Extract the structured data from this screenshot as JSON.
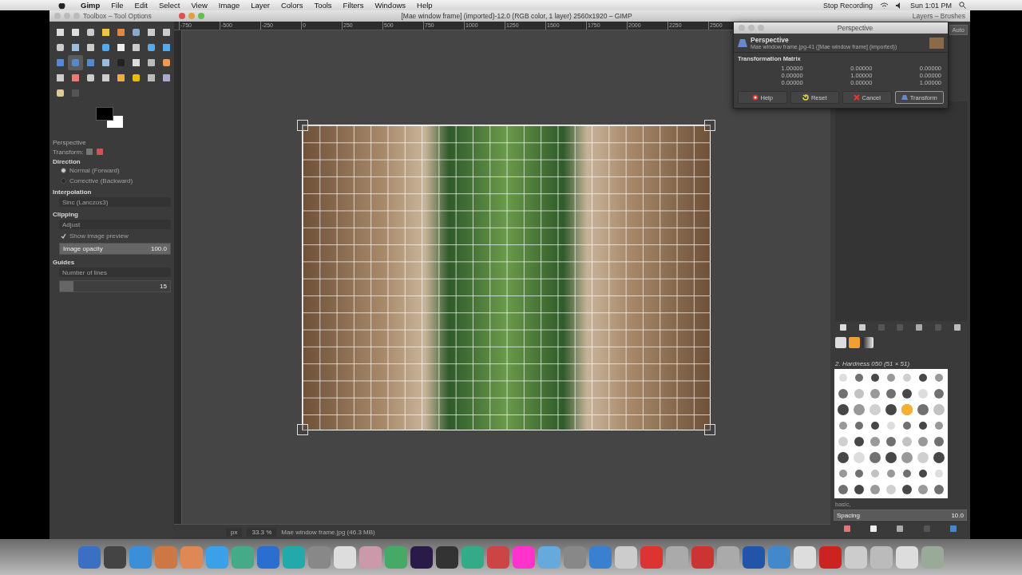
{
  "menu_bar": {
    "app": "Gimp",
    "menus": [
      "File",
      "Edit",
      "Select",
      "View",
      "Image",
      "Layer",
      "Colors",
      "Tools",
      "Filters",
      "Windows",
      "Help"
    ],
    "recording": "Stop Recording",
    "clock": "Sun 1:01 PM"
  },
  "toolbox": {
    "title": "Toolbox – Tool Options",
    "tools": [
      {
        "selected": false
      },
      {
        "selected": false
      },
      {
        "selected": false
      },
      {
        "selected": false
      },
      {
        "selected": false
      },
      {
        "selected": false
      },
      {
        "selected": false
      },
      {
        "selected": false
      },
      {
        "selected": false
      },
      {
        "selected": false
      },
      {
        "selected": false
      },
      {
        "selected": false
      },
      {
        "selected": false
      },
      {
        "selected": false
      },
      {
        "selected": false
      },
      {
        "selected": false
      },
      {
        "selected": false
      },
      {
        "selected": true
      },
      {
        "selected": false
      },
      {
        "selected": false
      },
      {
        "selected": false
      },
      {
        "selected": false
      },
      {
        "selected": false
      },
      {
        "selected": false
      },
      {
        "selected": false
      },
      {
        "selected": false
      },
      {
        "selected": false
      },
      {
        "selected": false
      },
      {
        "selected": false
      },
      {
        "selected": false
      },
      {
        "selected": false
      },
      {
        "selected": false
      },
      {
        "selected": false
      },
      {
        "selected": false
      }
    ],
    "tool_options": {
      "title": "Perspective",
      "transform_label": "Transform:",
      "direction": {
        "label": "Direction",
        "options": [
          {
            "label": "Normal (Forward)",
            "selected": true
          },
          {
            "label": "Corrective (Backward)",
            "selected": false
          }
        ]
      },
      "interpolation": {
        "label": "Interpolation",
        "value": "Sinc (Lanczos3)"
      },
      "clipping": {
        "label": "Clipping",
        "value": "Adjust"
      },
      "show_preview": {
        "label": "Show image preview",
        "checked": true
      },
      "image_opacity": {
        "label": "Image opacity",
        "value": "100.0",
        "level": 1
      },
      "guides": {
        "label": "Guides",
        "value": "Number of lines"
      },
      "lines": {
        "value": "15",
        "level": 0.12
      }
    }
  },
  "image_window": {
    "title": "[Mae window frame] (imported)-12.0 (RGB color, 1 layer) 2560x1920 – GIMP",
    "ruler": [
      "-750",
      "-500",
      "-250",
      "0",
      "250",
      "500",
      "750",
      "1000",
      "1250",
      "1500",
      "1750",
      "2000",
      "2250",
      "2500"
    ],
    "status": {
      "unit": "px",
      "zoom": "33.3 %",
      "message": "Mae window frame.jpg (46.3 MB)"
    }
  },
  "perspective_dialog": {
    "title": "Perspective",
    "heading": "Perspective",
    "subtitle": "Mae window frame.jpg-41 ([Mae window frame] (imported))",
    "matrix_title": "Transformation Matrix",
    "matrix": [
      [
        "1.00000",
        "0.00000",
        "0.00000"
      ],
      [
        "0.00000",
        "1.00000",
        "0.00000"
      ],
      [
        "0.00000",
        "0.00000",
        "1.00000"
      ]
    ],
    "buttons": [
      {
        "label": "Help",
        "kind": "help",
        "default": false
      },
      {
        "label": "Reset",
        "kind": "reset",
        "default": false
      },
      {
        "label": "Cancel",
        "kind": "cancel",
        "default": false
      },
      {
        "label": "Transform",
        "kind": "transform",
        "default": true
      }
    ]
  },
  "layers_brushes": {
    "title": "Layers – Brushes",
    "mode_button": "Auto",
    "brush_name": "2. Hardness 050 (51 × 51)",
    "tag": "basic,",
    "spacing": {
      "label": "Spacing",
      "value": "10.0",
      "level": 1
    }
  }
}
